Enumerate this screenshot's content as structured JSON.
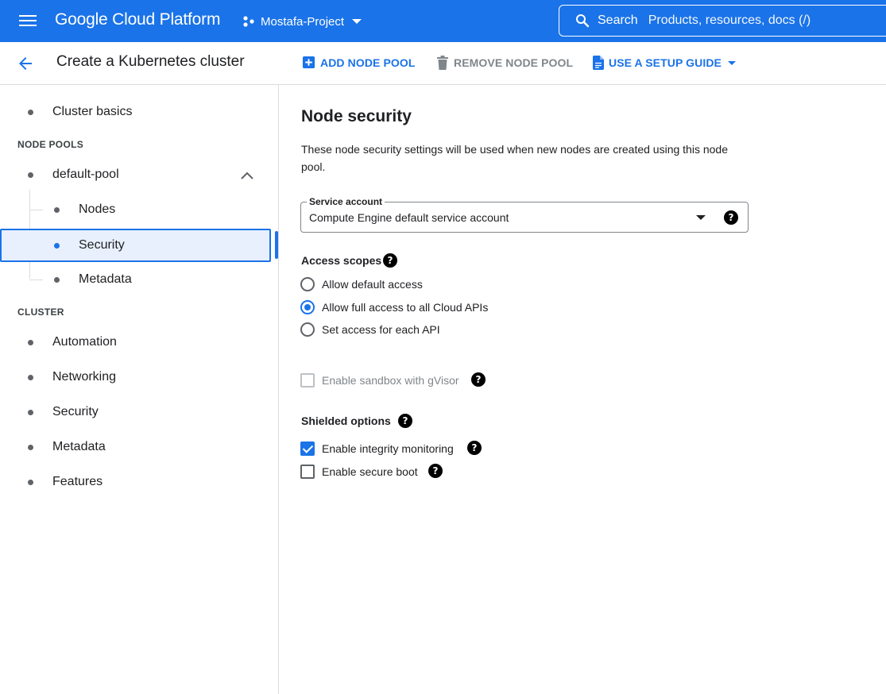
{
  "topbar": {
    "brand": "Google Cloud Platform",
    "project": "Mostafa-Project",
    "search_label": "Search",
    "search_placeholder": "Products, resources, docs (/)"
  },
  "subheader": {
    "title": "Create a Kubernetes cluster",
    "actions": [
      {
        "label": "ADD NODE POOL",
        "icon": "add-box-icon",
        "enabled": true
      },
      {
        "label": "REMOVE NODE POOL",
        "icon": "trash-icon",
        "enabled": false
      },
      {
        "label": "USE A SETUP GUIDE",
        "icon": "document-icon",
        "enabled": true
      }
    ]
  },
  "sidebar": {
    "cluster_basics": "Cluster basics",
    "node_pools_heading": "NODE POOLS",
    "default_pool": "default-pool",
    "pool_items": [
      "Nodes",
      "Security",
      "Metadata"
    ],
    "selected": "Security",
    "cluster_heading": "CLUSTER",
    "cluster_items": [
      "Automation",
      "Networking",
      "Security",
      "Metadata",
      "Features"
    ]
  },
  "main": {
    "title": "Node security",
    "description": "These node security settings will be used when new nodes are created using this node pool.",
    "service_account": {
      "label": "Service account",
      "value": "Compute Engine default service account"
    },
    "access_scopes": {
      "label": "Access scopes",
      "options": [
        {
          "label": "Allow default access",
          "selected": false
        },
        {
          "label": "Allow full access to all Cloud APIs",
          "selected": true
        },
        {
          "label": "Set access for each API",
          "selected": false
        }
      ]
    },
    "sandbox": {
      "label": "Enable sandbox with gVisor",
      "checked": false,
      "disabled": true
    },
    "shielded": {
      "label": "Shielded options",
      "options": [
        {
          "label": "Enable integrity monitoring",
          "checked": true
        },
        {
          "label": "Enable secure boot",
          "checked": false
        }
      ]
    }
  },
  "colors": {
    "brand_blue": "#1a73e8",
    "selected_bg": "#e8f0fe"
  }
}
